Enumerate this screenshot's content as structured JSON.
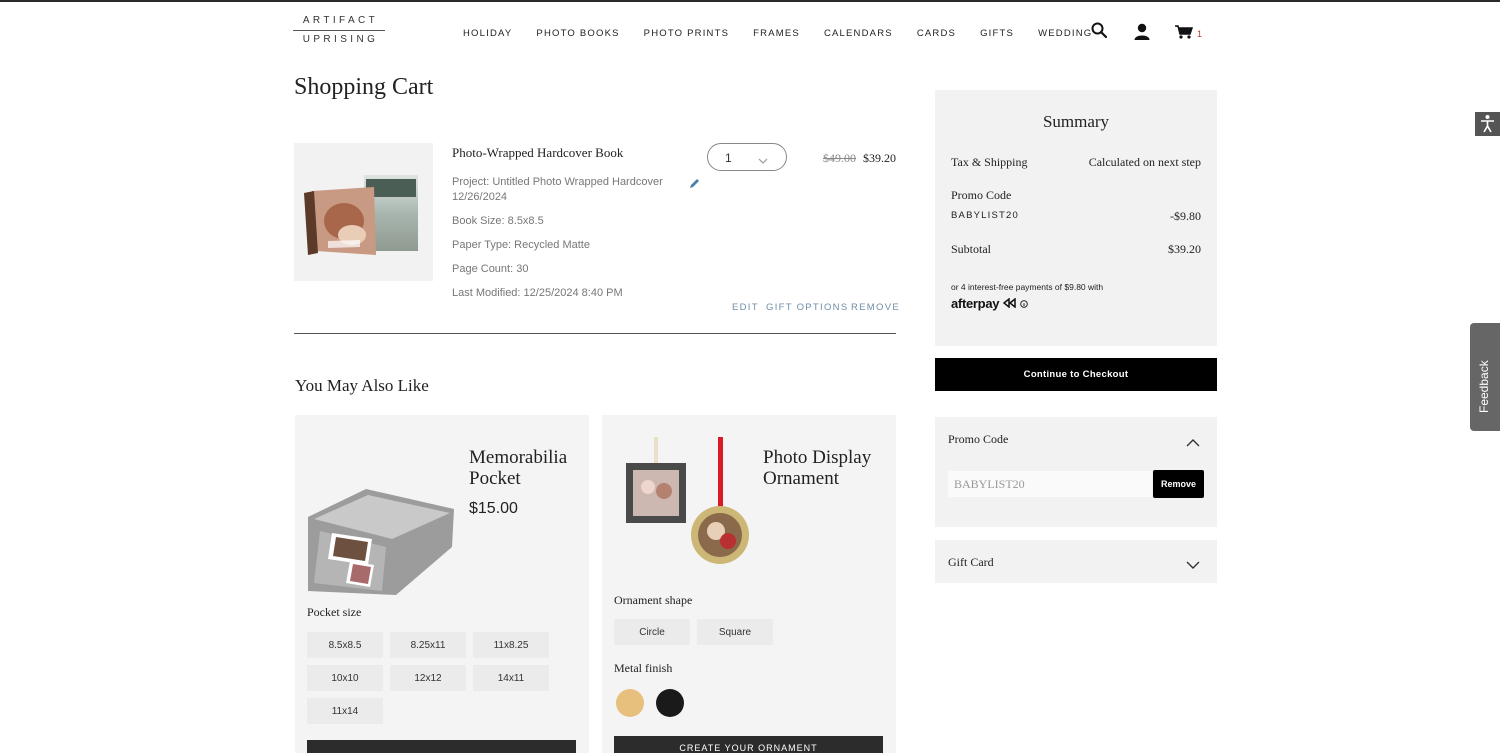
{
  "header": {
    "logo_line1": "ARTIFACT",
    "logo_line2": "UPRISING",
    "nav": [
      "HOLIDAY",
      "PHOTO BOOKS",
      "PHOTO PRINTS",
      "FRAMES",
      "CALENDARS",
      "CARDS",
      "GIFTS",
      "WEDDING"
    ],
    "cart_count": "1",
    "icons": [
      "search-icon",
      "account-icon",
      "cart-icon"
    ]
  },
  "cart": {
    "title": "Shopping Cart",
    "item": {
      "name": "Photo-Wrapped Hardcover Book",
      "project": "Project: Untitled Photo Wrapped Hardcover",
      "project_date": "12/26/2024",
      "book_size": "Book Size: 8.5x8.5",
      "paper_type": "Paper Type: Recycled Matte",
      "page_count": "Page Count: 30",
      "last_modified": "Last Modified: 12/25/2024 8:40 PM",
      "quantity": "1",
      "original_price": "$49.00",
      "price": "$39.20",
      "actions": {
        "edit": "EDIT",
        "gift": "GIFT OPTIONS",
        "remove": "REMOVE"
      }
    }
  },
  "recommendations": {
    "title": "You May Also Like",
    "pocket": {
      "name_line1": "Memorabilia",
      "name_line2": "Pocket",
      "price": "$15.00",
      "option_label": "Pocket size",
      "sizes": [
        "8.5x8.5",
        "8.25x11",
        "11x8.25",
        "10x10",
        "12x12",
        "14x11",
        "11x14"
      ]
    },
    "ornament": {
      "name_line1": "Photo Display",
      "name_line2": "Ornament",
      "shape_label": "Ornament shape",
      "shapes": [
        "Circle",
        "Square"
      ],
      "finish_label": "Metal finish",
      "finishes": [
        "#e8c07e",
        "#1a1a1a"
      ],
      "cta": "CREATE YOUR ORNAMENT"
    }
  },
  "summary": {
    "title": "Summary",
    "tax_label": "Tax & Shipping",
    "tax_value": "Calculated on next step",
    "promo_label": "Promo Code",
    "promo_code": "BABYLIST20",
    "promo_value": "-$9.80",
    "subtotal_label": "Subtotal",
    "subtotal_value": "$39.20",
    "afterpay_text": "or 4 interest-free payments of $9.80 with",
    "afterpay_logo": "afterpay",
    "checkout": "Continue to Checkout"
  },
  "promo_panel": {
    "title": "Promo Code",
    "input_value": "BABYLIST20",
    "remove": "Remove"
  },
  "gift_card": {
    "title": "Gift Card"
  },
  "feedback": "Feedback"
}
